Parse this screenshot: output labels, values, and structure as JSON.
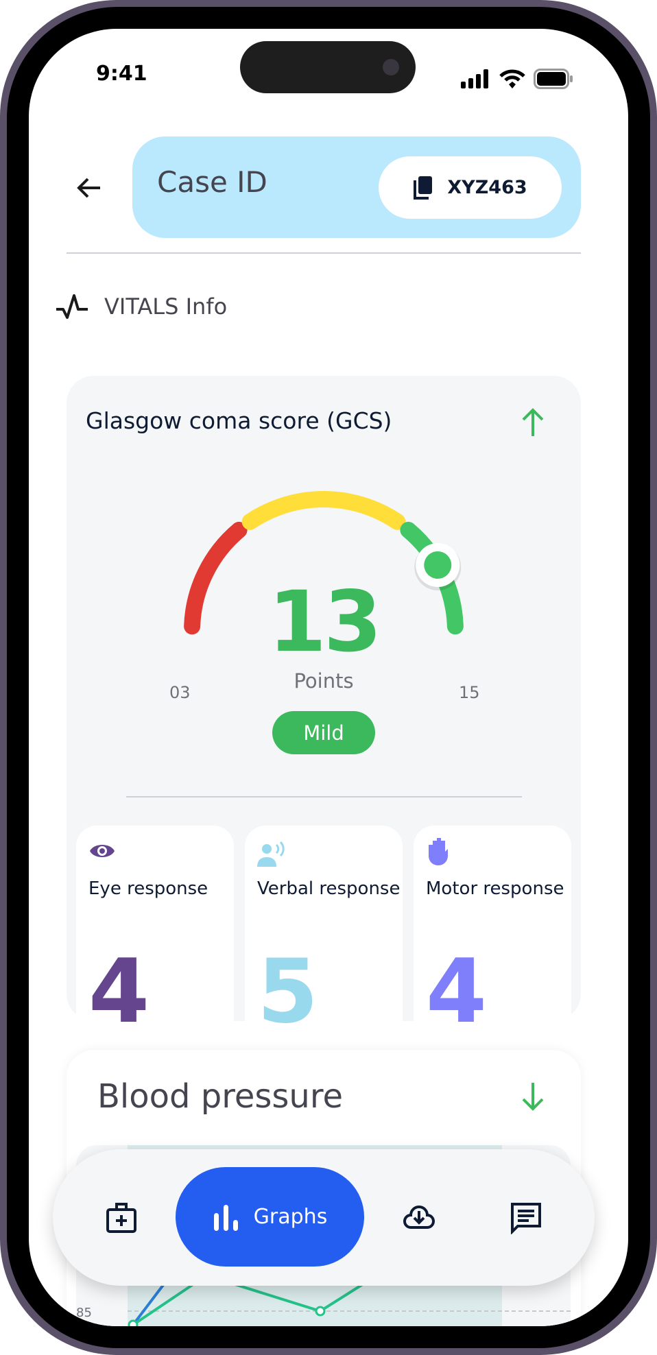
{
  "status_bar": {
    "time": "9:41"
  },
  "header": {
    "title": "Case ID",
    "case_id": "XYZ463",
    "back_icon": "arrow-left-icon",
    "copy_icon": "copy-icon"
  },
  "section": {
    "title": "VITALS Info",
    "icon": "pulse-icon"
  },
  "gcs": {
    "title": "Glasgow coma score (GCS)",
    "trend": "up",
    "value": 13,
    "value_text": "13",
    "unit": "Points",
    "min": 3,
    "max": 15,
    "min_label": "03",
    "max_label": "15",
    "severity": "Mild",
    "colors": {
      "severe": "#e03a33",
      "moderate": "#ffde3a",
      "mild": "#43c766",
      "accent": "#3cb95c"
    },
    "responses": [
      {
        "label": "Eye response",
        "value": "4",
        "icon": "eye-icon",
        "color": "#65468e"
      },
      {
        "label": "Verbal response",
        "value": "5",
        "icon": "speaking-person-icon",
        "color": "#98d9ee"
      },
      {
        "label": "Motor response",
        "value": "4",
        "icon": "raised-hand-icon",
        "color": "#7f7ffc"
      }
    ]
  },
  "blood_pressure": {
    "title": "Blood pressure",
    "trend": "down",
    "axis_label": "85"
  },
  "nav": {
    "items": [
      {
        "label": "",
        "icon": "medical-kit-icon"
      },
      {
        "label": "Graphs",
        "icon": "bar-chart-icon",
        "active": true
      },
      {
        "label": "",
        "icon": "cloud-download-icon"
      },
      {
        "label": "",
        "icon": "message-icon"
      }
    ],
    "accent": "#235ef0"
  }
}
